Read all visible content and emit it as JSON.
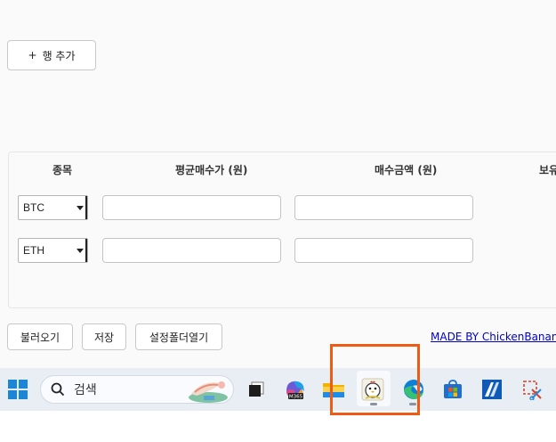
{
  "toolbar": {
    "add_row_icon": "+",
    "add_row_label": "행 추가"
  },
  "table": {
    "columns": [
      "종목",
      "평균매수가 (원)",
      "매수금액 (원)",
      "보유"
    ],
    "rows": [
      {
        "symbol": "BTC",
        "avg_price": "",
        "amount": ""
      },
      {
        "symbol": "ETH",
        "avg_price": "",
        "amount": ""
      }
    ]
  },
  "actions": {
    "load_label": "불러오기",
    "save_label": "저장",
    "open_folder_label": "설정폴더열기"
  },
  "credit": "MADE BY ChickenBanana",
  "taskbar": {
    "search_placeholder": "검색",
    "m365_label": "M365",
    "icons": [
      "windows-start-icon",
      "search-icon",
      "task-view-icon",
      "copilot-m365-icon",
      "file-explorer-icon",
      "app-chicken-icon",
      "edge-icon",
      "microsoft-store-icon",
      "autocad-icon",
      "snipping-tool-icon"
    ]
  },
  "colors": {
    "highlight": "#f05a14",
    "link": "#0000cc",
    "taskbar": "#e9eef5"
  }
}
